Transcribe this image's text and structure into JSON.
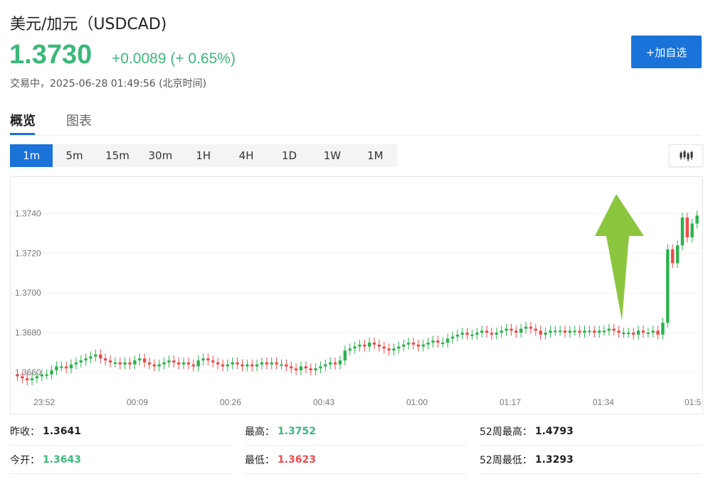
{
  "header": {
    "title": "美元/加元（USDCAD)",
    "price": "1.3730",
    "change": "+0.0089 (+ 0.65%)",
    "status": "交易中，2025-06-28 01:49:56 (北京时间)",
    "add_watchlist": "+加自选"
  },
  "tabs": [
    {
      "label": "概览",
      "active": true
    },
    {
      "label": "图表",
      "active": false
    }
  ],
  "intervals": [
    "1m",
    "5m",
    "15m",
    "30m",
    "1H",
    "4H",
    "1D",
    "1W",
    "1M"
  ],
  "active_interval": "1m",
  "chart_type_icon": "candlestick-icon",
  "colors": {
    "up": "#2bb24c",
    "down": "#ee4b4b",
    "accent": "#1a73d9",
    "price_up": "#3cb87b",
    "arrow": "#8cc63f"
  },
  "stats": [
    {
      "label": "昨收：",
      "value": "1.3641",
      "color": "#222222"
    },
    {
      "label": "最高：",
      "value": "1.3752",
      "color": "#3cb87b"
    },
    {
      "label": "52周最高：",
      "value": "1.4793",
      "color": "#222222"
    },
    {
      "label": "今开：",
      "value": "1.3643",
      "color": "#3cb87b"
    },
    {
      "label": "最低：",
      "value": "1.3623",
      "color": "#ee4b4b"
    },
    {
      "label": "52周最低：",
      "value": "1.3293",
      "color": "#222222"
    }
  ],
  "chart_data": {
    "type": "candlestick",
    "y_ticks": [
      "1.3740",
      "1.3720",
      "1.3700",
      "1.3680",
      "1.3660"
    ],
    "y_tick_values": [
      1.374,
      1.372,
      1.37,
      1.368,
      1.366
    ],
    "x_ticks": [
      "23:52",
      "00:09",
      "00:26",
      "00:43",
      "01:00",
      "01:17",
      "01:34",
      "01:5"
    ],
    "ylim": [
      1.3651,
      1.3752
    ],
    "annotation": "up-arrow",
    "closes": [
      1.3658,
      1.3657,
      1.3656,
      1.3657,
      1.3658,
      1.3659,
      1.3659,
      1.3661,
      1.3663,
      1.3663,
      1.3662,
      1.3664,
      1.3665,
      1.3666,
      1.3667,
      1.3668,
      1.3669,
      1.3667,
      1.3666,
      1.3665,
      1.3665,
      1.3664,
      1.3665,
      1.3664,
      1.3666,
      1.3667,
      1.3665,
      1.3664,
      1.3663,
      1.3664,
      1.3665,
      1.3666,
      1.3665,
      1.3664,
      1.3665,
      1.3664,
      1.3663,
      1.3666,
      1.3667,
      1.3666,
      1.3665,
      1.3664,
      1.3663,
      1.3664,
      1.3665,
      1.3664,
      1.3663,
      1.3664,
      1.3663,
      1.3664,
      1.3665,
      1.3664,
      1.3665,
      1.3664,
      1.3664,
      1.3663,
      1.3662,
      1.3661,
      1.3663,
      1.3662,
      1.3661,
      1.3662,
      1.3663,
      1.3664,
      1.3665,
      1.3664,
      1.3666,
      1.3671,
      1.3672,
      1.3673,
      1.3674,
      1.3673,
      1.3675,
      1.3674,
      1.3673,
      1.3672,
      1.3671,
      1.3672,
      1.3673,
      1.3674,
      1.3675,
      1.3674,
      1.3673,
      1.3674,
      1.3675,
      1.3676,
      1.3675,
      1.3675,
      1.3677,
      1.3678,
      1.3679,
      1.368,
      1.3679,
      1.3679,
      1.368,
      1.3681,
      1.368,
      1.3679,
      1.368,
      1.3681,
      1.3682,
      1.3681,
      1.368,
      1.3682,
      1.3683,
      1.3682,
      1.3681,
      1.3679,
      1.368,
      1.3681,
      1.3681,
      1.3681,
      1.368,
      1.3681,
      1.3681,
      1.368,
      1.3681,
      1.3681,
      1.368,
      1.3681,
      1.3681,
      1.3682,
      1.3681,
      1.368,
      1.368,
      1.368,
      1.3679,
      1.3681,
      1.368,
      1.368,
      1.3681,
      1.3679,
      1.3685,
      1.3722,
      1.3715,
      1.3724,
      1.3738,
      1.3728,
      1.3735,
      1.3739
    ]
  }
}
